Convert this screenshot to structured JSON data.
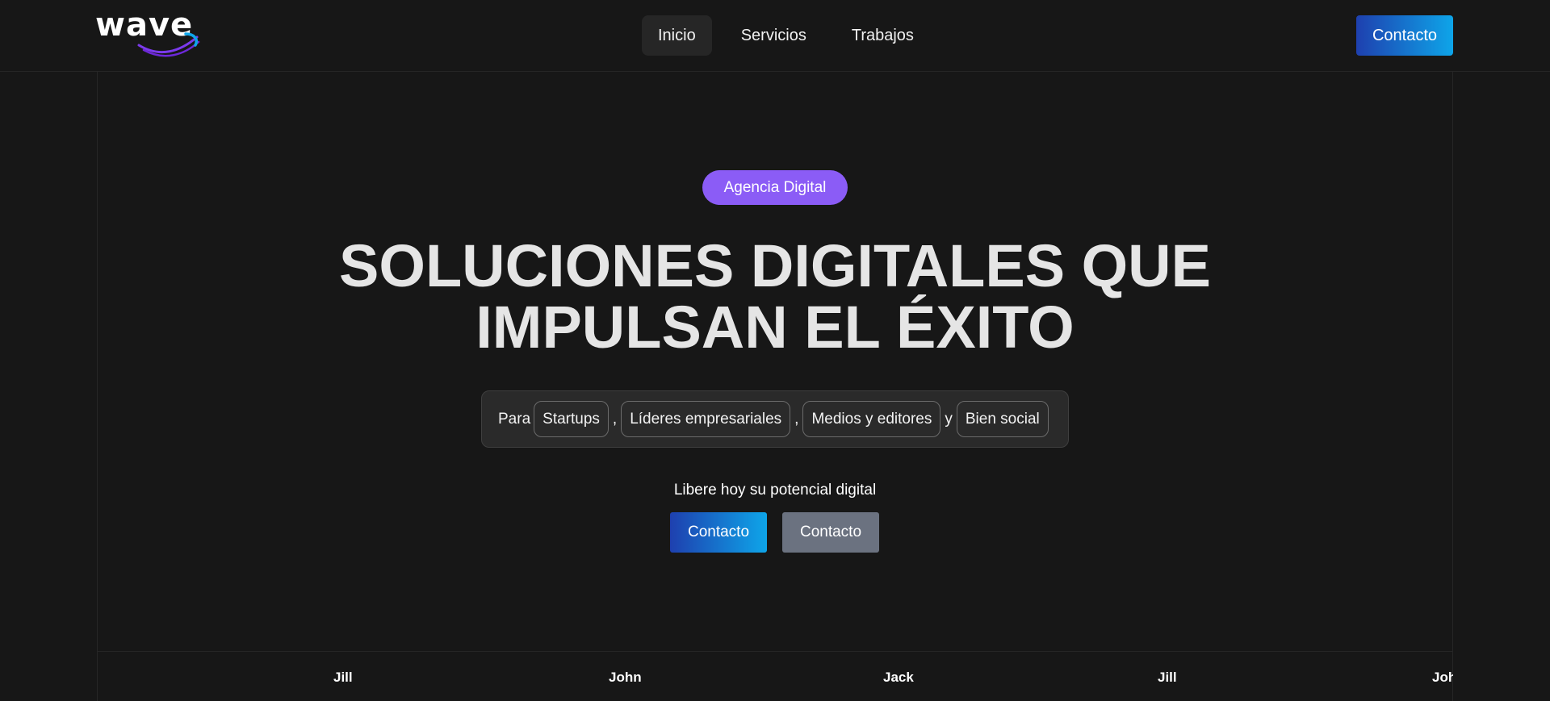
{
  "header": {
    "logo_text": "wave",
    "nav": [
      {
        "label": "Inicio",
        "active": true
      },
      {
        "label": "Servicios",
        "active": false
      },
      {
        "label": "Trabajos",
        "active": false
      }
    ],
    "cta_label": "Contacto"
  },
  "hero": {
    "badge": "Agencia Digital",
    "headline_line1": "SOLUCIONES DIGITALES QUE",
    "headline_line2": "IMPULSAN EL ÉXITO",
    "audience": {
      "prefix": "Para",
      "chips": [
        "Startups",
        "Líderes empresariales",
        "Medios y editores",
        "Bien social"
      ],
      "separator": ",",
      "conjunction": "y"
    },
    "tagline": "Libere hoy su potencial digital",
    "primary_button": "Contacto",
    "secondary_button": "Contacto"
  },
  "marquee": {
    "items": [
      "Jill",
      "John",
      "Jack",
      "Jill",
      "John"
    ]
  },
  "colors": {
    "background": "#171717",
    "badge": "#8b5cf6",
    "gradient_start": "#1e40af",
    "gradient_end": "#0ea5e9",
    "secondary_button": "#6b7280"
  }
}
